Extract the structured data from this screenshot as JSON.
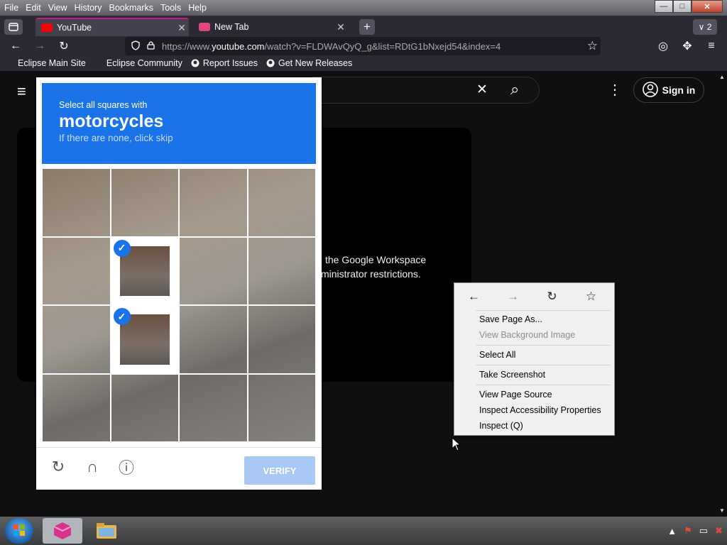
{
  "menubar": {
    "items": [
      "File",
      "Edit",
      "View",
      "History",
      "Bookmarks",
      "Tools",
      "Help"
    ],
    "win_min": "—",
    "win_max": "□",
    "win_close": "✕"
  },
  "tabs": {
    "items": [
      {
        "label": "YouTube",
        "close": "✕"
      },
      {
        "label": "New Tab",
        "close": "✕"
      }
    ],
    "new_tab": "+",
    "count": "∨ 2"
  },
  "navbar": {
    "url_scheme": "https://www.",
    "url_host": "youtube.com",
    "url_path": "/watch?v=FLDWAvQyQ_g&list=RDtG1bNxejd54&index=4",
    "back": "←",
    "forward": "→",
    "reload": "↻",
    "star": "☆",
    "account": "◎",
    "extensions": "✥",
    "menu": "≡"
  },
  "bookmarks": [
    "Eclipse Main Site",
    "Eclipse Community",
    "Report Issues",
    "Get New Releases"
  ],
  "youtube": {
    "sign_in": "Sign in",
    "clear_search": "✕",
    "search_icon": "⌕",
    "more": "⋮",
    "menu": "≡",
    "message_line1": "the Google Workspace",
    "message_line2": "ministrator restrictions."
  },
  "captcha": {
    "instruction": "Select all squares with",
    "target": "motorcycles",
    "hint": "If there are none, click skip",
    "verify": "VERIFY",
    "reload_icon": "↻",
    "audio_icon": "∩",
    "info_icon": "ⓘ",
    "check": "✓",
    "selected_cells": [
      5,
      9
    ]
  },
  "context_menu": {
    "back": "←",
    "forward": "→",
    "reload": "↻",
    "bookmark": "☆",
    "save_page_as": "Save Page As...",
    "view_background_image": "View Background Image",
    "select_all": "Select All",
    "take_screenshot": "Take Screenshot",
    "view_page_source": "View Page Source",
    "inspect_accessibility": "Inspect Accessibility Properties",
    "inspect": "Inspect (Q)"
  },
  "taskbar": {
    "tray_up": "▲",
    "tray_flag": "⚑",
    "tray_net": "▭",
    "tray_vol": "✖"
  },
  "colors": {
    "accent": "#c21f83",
    "captcha_blue": "#1a73e8"
  }
}
